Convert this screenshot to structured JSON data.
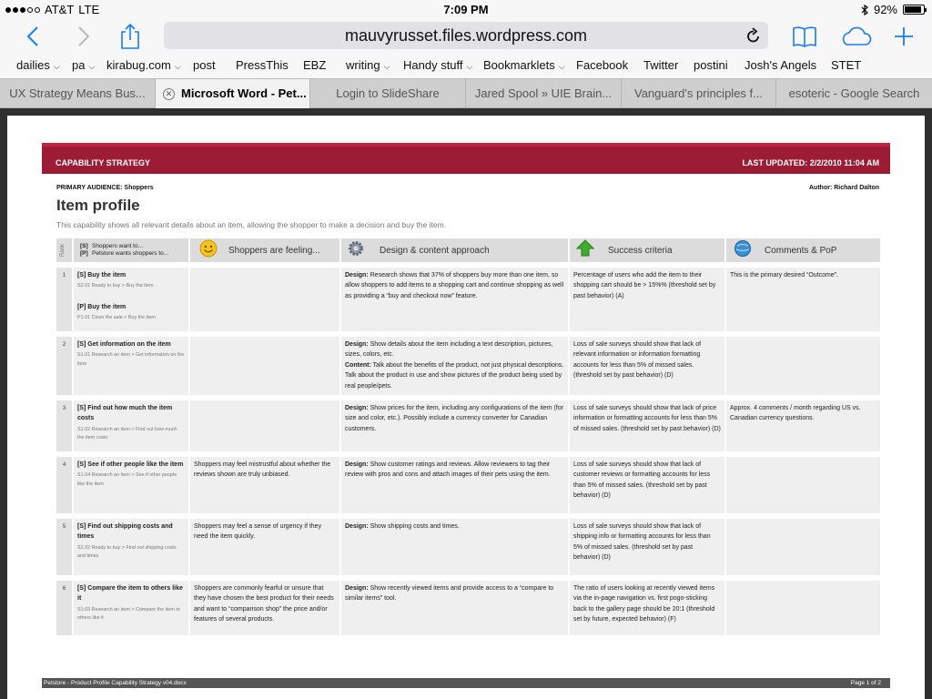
{
  "status": {
    "carrier": "AT&T",
    "network": "LTE",
    "time": "7:09 PM",
    "battery": "92%",
    "battery_level": 0.92
  },
  "browser": {
    "url": "mauvyrusset.files.wordpress.com",
    "bookmarks": [
      {
        "label": "dailies",
        "folder": true
      },
      {
        "label": "pa",
        "folder": true
      },
      {
        "label": "kirabug.com",
        "folder": true
      },
      {
        "label": "post",
        "folder": false
      },
      {
        "label": "PressThis",
        "folder": false
      },
      {
        "label": "EBZ",
        "folder": false
      },
      {
        "label": "writing",
        "folder": true
      },
      {
        "label": "Handy stuff",
        "folder": true
      },
      {
        "label": "Bookmarklets",
        "folder": true
      },
      {
        "label": "Facebook",
        "folder": false
      },
      {
        "label": "Twitter",
        "folder": false
      },
      {
        "label": "postini",
        "folder": false
      },
      {
        "label": "Josh's Angels",
        "folder": false
      },
      {
        "label": "STET",
        "folder": false
      }
    ],
    "tabs": [
      {
        "label": "UX Strategy Means Bus..."
      },
      {
        "label": "Microsoft Word - Pet...",
        "active": true
      },
      {
        "label": "Login to SlideShare"
      },
      {
        "label": "Jared Spool » UIE Brain..."
      },
      {
        "label": "Vanguard's principles f..."
      },
      {
        "label": "esoteric - Google Search"
      }
    ]
  },
  "doc": {
    "banner_left": "CAPABILITY STRATEGY",
    "banner_right": "LAST UPDATED: 2/2/2010 11:04 AM",
    "audience": "PRIMARY AUDIENCE: Shoppers",
    "author": "Author: Richard Dalton",
    "title": "Item profile",
    "description": "This capability shows all relevant details about an item, allowing the shopper to make a decision and buy the item.",
    "headers": {
      "rank": "Rank",
      "s_tag": "[S]",
      "s_text": "Shoppers want to...",
      "p_tag": "[P]",
      "p_text": "Petstore wants shoppers to...",
      "feeling": "Shoppers are feeling...",
      "design": "Design & content approach",
      "success": "Success criteria",
      "comments": "Comments & PoP"
    },
    "design_label": "Design:",
    "content_label": "Content:",
    "rows": [
      {
        "rank": "1",
        "story": "[S] Buy the item",
        "path": "S2.01 Ready to buy > Buy the item",
        "story2": "[P] Buy the item",
        "path2": "P1.01 Close the sale > Buy the item",
        "feeling": "",
        "design": "Research shows that 37% of shoppers buy more than one item, so allow shoppers to add items to a shopping cart and continue shopping as well as providing a “buy and checkout now” feature.",
        "content": "",
        "success": "Percentage of users who add the item to their shopping cart should be > 15%% (threshold set by past behavior) (A)",
        "comments": "This is the primary desired “Outcome”."
      },
      {
        "rank": "2",
        "story": "[S] Get information on the item",
        "path": "S1.01 Research an item > Get information on the item",
        "feeling": "",
        "design": "Show details about the item including a text description, pictures, sizes, colors, etc.",
        "content": "Talk about the benefits of the product, not just physical descriptions. Talk about the product in use and show pictures of the product being used by real people/pets.",
        "success": "Loss of sale surveys should show that lack of relevant information or information formatting accounts for less than 5% of missed sales. (threshold set by past behavior) (D)",
        "comments": ""
      },
      {
        "rank": "3",
        "story": "[S] Find out how much the item costs",
        "path": "S1.02 Research an item > Find out how much the item costs",
        "feeling": "",
        "design": "Show prices for the item, including any configurations of the item (for size and color, etc.). Possibly include a currency converter for Canadian customers.",
        "content": "",
        "success": "Loss of sale surveys should show that lack of price information or formatting accounts for less than 5% of missed sales. (threshold set by past behavior) (D)",
        "comments": "Approx. 4 comments / month regarding US vs. Canadian currency questions."
      },
      {
        "rank": "4",
        "story": "[S] See if other people like the item",
        "path": "S1.04 Research an item > See if other people like the item",
        "feeling": "Shoppers may feel mistrustful about whether the reviews shown are truly unbiased.",
        "design": "Show customer ratings and reviews. Allow reviewers to tag their review with pros and cons and attach images of their pets using the item.",
        "content": "",
        "success": "Loss of sale surveys should show that lack of customer reviews or formatting accounts for less than 5% of missed sales. (threshold set by past behavior) (D)",
        "comments": ""
      },
      {
        "rank": "5",
        "story": "[S] Find out shipping costs and times",
        "path": "S2.02 Ready to buy > Find out shipping costs and times",
        "feeling": "Shoppers may feel a sense of urgency if they need the item quickly.",
        "design": "Show shipping costs and times.",
        "content": "",
        "success": "Loss of sale surveys should show that lack of shipping info or formatting accounts for less than 5% of missed sales. (threshold set by past behavior) (D)",
        "comments": ""
      },
      {
        "rank": "6",
        "story": "[S] Compare the item to others like it",
        "path": "S1.03 Research an item > Compare the item to others like it",
        "feeling": "Shoppers are commonly fearful or unsure that they have chosen the best product for their needs and want to “comparison shop” the price and/or features of several products.",
        "design": "Show recently viewed items and provide access to a “compare to similar items” tool.",
        "content": "",
        "success": "The ratio of users looking at recently viewed items via the in-page navigation vs. first pogo-sticking back to the gallery page should be 20:1 (threshold set by future, expected behavior) (F)",
        "comments": ""
      }
    ],
    "footer_left": "Petstore - Product Profile Capability Strategy v04.docx",
    "footer_right": "Page 1 of 2"
  },
  "icons": {
    "back": "chevron-left-icon",
    "forward": "chevron-right-icon",
    "share": "share-icon",
    "reload": "reload-icon",
    "bookmarks": "book-icon",
    "cloud": "cloud-icon",
    "add": "plus-icon",
    "feeling": "smiley-icon",
    "design": "gear-icon",
    "success": "up-arrow-icon",
    "comments": "globe-icon"
  },
  "colors": {
    "accent": "#1a7cf3",
    "banner": "#9b1c34"
  }
}
